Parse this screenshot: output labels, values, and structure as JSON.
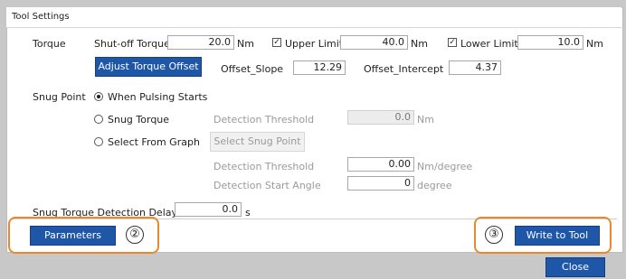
{
  "window": {
    "title": "Tool Settings"
  },
  "torque": {
    "label": "Torque",
    "shutoff_label": "Shut-off Torque",
    "shutoff_value": "20.0",
    "shutoff_unit": "Nm",
    "upper_limit_label": "Upper Limit",
    "upper_limit_checked": true,
    "upper_limit_value": "40.0",
    "upper_limit_unit": "Nm",
    "lower_limit_label": "Lower Limit",
    "lower_limit_checked": true,
    "lower_limit_value": "10.0",
    "lower_limit_unit": "Nm",
    "adjust_button": "Adjust Torque Offset",
    "offset_slope_label": "Offset_Slope",
    "offset_slope_value": "12.29",
    "offset_intercept_label": "Offset_Intercept",
    "offset_intercept_value": "4.37"
  },
  "snug": {
    "label": "Snug Point",
    "option_pulsing": "When Pulsing Starts",
    "option_torque": "Snug Torque",
    "option_graph": "Select From Graph",
    "selected": "When Pulsing Starts",
    "detection_threshold_label": "Detection Threshold",
    "detection_threshold_value": "0.0",
    "detection_threshold_unit": "Nm",
    "select_point_button": "Select Snug Point",
    "graph_threshold_label": "Detection Threshold",
    "graph_threshold_value": "0.00",
    "graph_threshold_unit": "Nm/degree",
    "start_angle_label": "Detection Start Angle",
    "start_angle_value": "0",
    "start_angle_unit": "degree"
  },
  "delay": {
    "label": "Snug Torque Detection Delay",
    "value": "0.0",
    "unit": "s"
  },
  "footer": {
    "parameters_button": "Parameters",
    "callout_2": "②",
    "write_button": "Write to Tool",
    "callout_3": "③",
    "close_button": "Close"
  },
  "colors": {
    "accent": "#1e56a8",
    "highlight": "#e58a2e"
  }
}
